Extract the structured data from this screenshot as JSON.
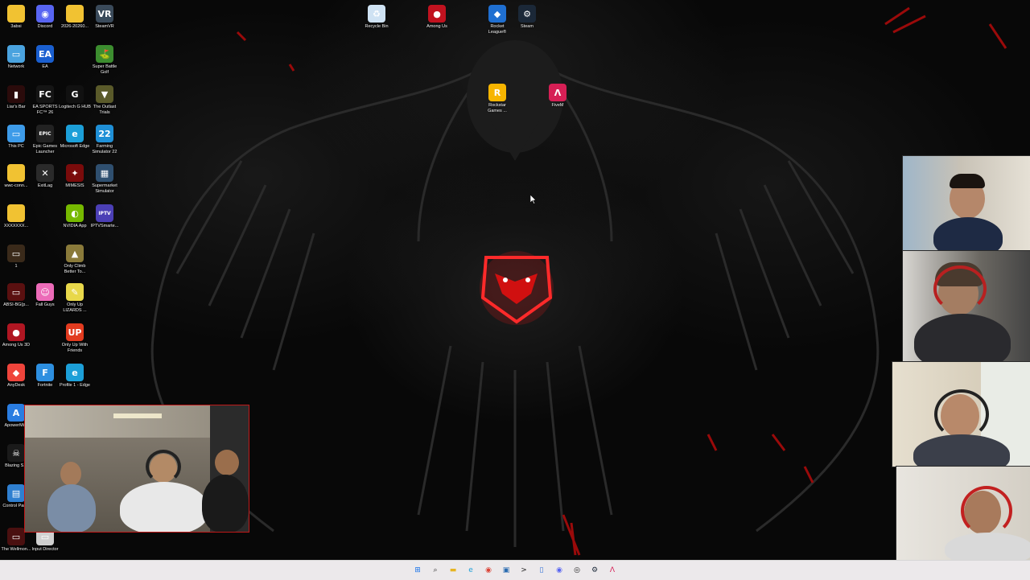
{
  "desktop": {
    "icons": [
      {
        "label": "3absi",
        "icon": "folder-icon",
        "color": "#f1c232",
        "glyph": ""
      },
      {
        "label": "Discord",
        "icon": "discord-icon",
        "color": "#5865f2",
        "glyph": "◉"
      },
      {
        "label": "2026-20260...",
        "icon": "folder-icon",
        "color": "#f1c232",
        "glyph": ""
      },
      {
        "label": "SteamVR",
        "icon": "steamvr-icon",
        "color": "#3a4a5a",
        "glyph": "VR"
      },
      {
        "label": "Recycle Bin",
        "icon": "recycle-bin-icon",
        "color": "#cfe2f3",
        "glyph": "♻"
      },
      {
        "label": "Among Us",
        "icon": "among-us-icon",
        "color": "#c1121f",
        "glyph": "●"
      },
      {
        "label": "Rocket League®",
        "icon": "rocket-league-icon",
        "color": "#1f6fd1",
        "glyph": "◆"
      },
      {
        "label": "Steam",
        "icon": "steam-icon",
        "color": "#1b2838",
        "glyph": "⚙"
      },
      {
        "label": "Network",
        "icon": "network-icon",
        "color": "#4aa3df",
        "glyph": "▭"
      },
      {
        "label": "EA",
        "icon": "ea-icon",
        "color": "#1a5fd0",
        "glyph": "EA"
      },
      {
        "label": "Super Battle Golf",
        "icon": "super-battle-golf-icon",
        "color": "#3c8d2f",
        "glyph": "⛳"
      },
      {
        "label": "Rockstar Games ...",
        "icon": "rockstar-games-icon",
        "color": "#f7b500",
        "glyph": "R"
      },
      {
        "label": "FiveM",
        "icon": "fivem-icon",
        "color": "#d61f55",
        "glyph": "Λ"
      },
      {
        "label": "Liar's Bar",
        "icon": "liars-bar-icon",
        "color": "#2b0b0b",
        "glyph": "▮"
      },
      {
        "label": "EA SPORTS FC™ 26",
        "icon": "ea-sports-fc-icon",
        "color": "#151515",
        "glyph": "FC"
      },
      {
        "label": "Logitech G HUB",
        "icon": "logitech-g-hub-icon",
        "color": "#111111",
        "glyph": "G"
      },
      {
        "label": "The Outlast Trials",
        "icon": "outlast-trials-icon",
        "color": "#5a5a2a",
        "glyph": "▼"
      },
      {
        "label": "This PC",
        "icon": "this-pc-icon",
        "color": "#3d9be9",
        "glyph": "▭"
      },
      {
        "label": "Epic Games Launcher",
        "icon": "epic-games-icon",
        "color": "#222222",
        "glyph": "EPIC"
      },
      {
        "label": "Microsoft Edge",
        "icon": "edge-icon",
        "color": "#1c9fd8",
        "glyph": "e"
      },
      {
        "label": "Farming Simulator 22",
        "icon": "farming-simulator-icon",
        "color": "#1f8fd6",
        "glyph": "22"
      },
      {
        "label": "wwc-conn...",
        "icon": "folder-icon",
        "color": "#f1c232",
        "glyph": ""
      },
      {
        "label": "ExitLag",
        "icon": "exitlag-icon",
        "color": "#2a2a2a",
        "glyph": "✕"
      },
      {
        "label": "MIMESIS",
        "icon": "mimesis-icon",
        "color": "#7a0b0b",
        "glyph": "✦"
      },
      {
        "label": "Supermarket Simulator",
        "icon": "supermarket-simulator-icon",
        "color": "#2f4f6f",
        "glyph": "▦"
      },
      {
        "label": "XXXXXXX...",
        "icon": "folder-icon",
        "color": "#f1c232",
        "glyph": ""
      },
      {
        "label": "NVIDIA App",
        "icon": "nvidia-app-icon",
        "color": "#76b900",
        "glyph": "◐"
      },
      {
        "label": "IPTVSmarte...",
        "icon": "iptv-smarters-icon",
        "color": "#4b3fb5",
        "glyph": "IPTV"
      },
      {
        "label": "1",
        "icon": "file-icon",
        "color": "#3a2a1a",
        "glyph": "▭"
      },
      {
        "label": "Only Climb Better To...",
        "icon": "only-climb-icon",
        "color": "#8a7a3a",
        "glyph": "▲"
      },
      {
        "label": "ABSI-BG(p...",
        "icon": "image-file-icon",
        "color": "#5a1010",
        "glyph": "▭"
      },
      {
        "label": "Fall Guys",
        "icon": "fall-guys-icon",
        "color": "#ec6bb8",
        "glyph": "☺"
      },
      {
        "label": "Only Up LIZARDS ...",
        "icon": "only-up-lizards-icon",
        "color": "#e8d84a",
        "glyph": "✎"
      },
      {
        "label": "Among Us 3D",
        "icon": "among-us-3d-icon",
        "color": "#b01622",
        "glyph": "●"
      },
      {
        "label": "Only Up With Friends",
        "icon": "only-up-friends-icon",
        "color": "#e23b1f",
        "glyph": "UP"
      },
      {
        "label": "AnyDesk",
        "icon": "anydesk-icon",
        "color": "#ef443b",
        "glyph": "◆"
      },
      {
        "label": "Fortnite",
        "icon": "fortnite-icon",
        "color": "#2d8fe0",
        "glyph": "F"
      },
      {
        "label": "Profile 1 - Edge",
        "icon": "edge-profile-icon",
        "color": "#1c9fd8",
        "glyph": "e"
      },
      {
        "label": "ApowerMi...",
        "icon": "apowermirror-icon",
        "color": "#2a7de1",
        "glyph": "A"
      },
      {
        "label": "Blazing S...",
        "icon": "blazing-sails-icon",
        "color": "#1a1a1a",
        "glyph": "☠"
      },
      {
        "label": "Control Panel",
        "icon": "control-panel-icon",
        "color": "#2f7fd0",
        "glyph": "▤"
      },
      {
        "label": "The Wellmon...",
        "icon": "wellmon-icon",
        "color": "#4a1010",
        "glyph": "▭"
      },
      {
        "label": "Input Director",
        "icon": "input-director-icon",
        "color": "#d0d0d0",
        "glyph": "▭"
      }
    ]
  },
  "wallpaper": {
    "accent_color": "#ff2020",
    "base_color": "#080808",
    "emblem": "eagle-logo-icon"
  },
  "webcams": [
    {
      "name": "webcam-group-bottom-left",
      "bg": "#6d665c"
    },
    {
      "name": "webcam-top-right",
      "bg": "#b8b2a6"
    },
    {
      "name": "webcam-second-right",
      "bg": "#5c5a55"
    },
    {
      "name": "webcam-third-right",
      "bg": "#d9d2c4"
    },
    {
      "name": "webcam-bottom-right",
      "bg": "#ddd8cf"
    }
  ],
  "taskbar": {
    "items": [
      {
        "icon": "windows-start-icon",
        "color": "#1a73e8",
        "glyph": "⊞"
      },
      {
        "icon": "search-icon",
        "color": "#333333",
        "glyph": "⌕"
      },
      {
        "icon": "file-explorer-icon",
        "color": "#e6b422",
        "glyph": "▬"
      },
      {
        "icon": "edge-icon",
        "color": "#1c9fd8",
        "glyph": "e"
      },
      {
        "icon": "chrome-icon",
        "color": "#db4437",
        "glyph": "◉"
      },
      {
        "icon": "store-icon",
        "color": "#2b6cb0",
        "glyph": "▣"
      },
      {
        "icon": "terminal-icon",
        "color": "#222222",
        "glyph": ">"
      },
      {
        "icon": "notepad-icon",
        "color": "#2f6fd6",
        "glyph": "▯"
      },
      {
        "icon": "discord-icon",
        "color": "#5865f2",
        "glyph": "◉"
      },
      {
        "icon": "obs-icon",
        "color": "#222222",
        "glyph": "◎"
      },
      {
        "icon": "steam-icon",
        "color": "#1b2838",
        "glyph": "⚙"
      },
      {
        "icon": "fivem-icon",
        "color": "#d61f55",
        "glyph": "Λ"
      }
    ]
  }
}
